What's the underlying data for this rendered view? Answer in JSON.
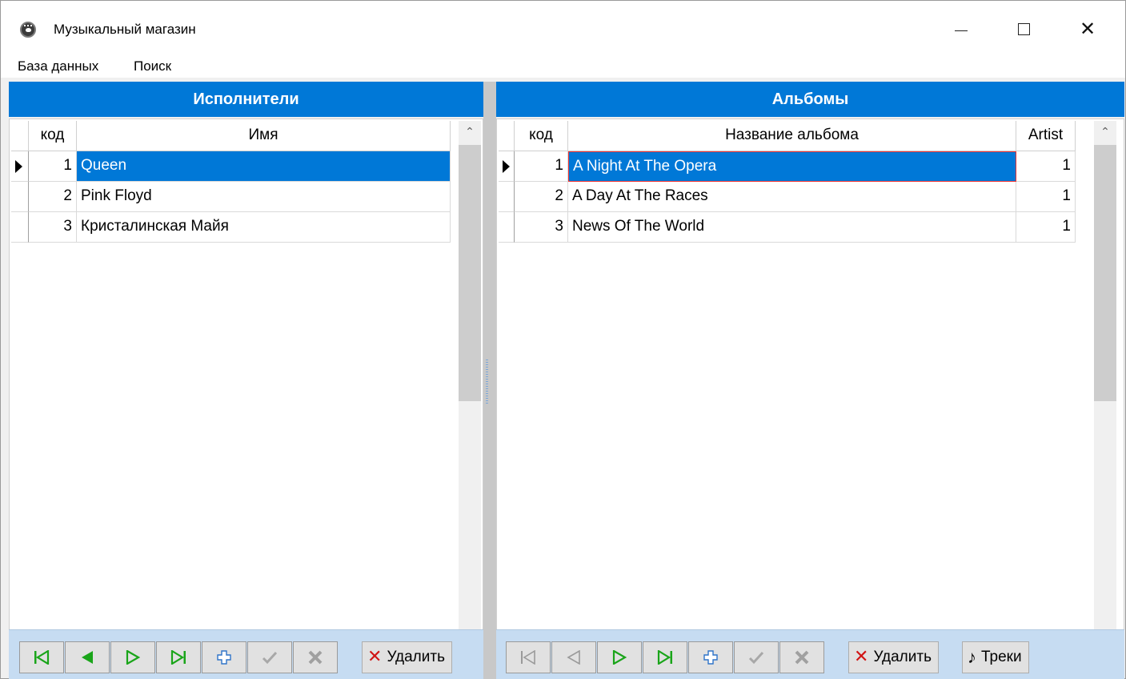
{
  "window": {
    "title": "Музыкальный магазин",
    "minimize": "",
    "maximize": "",
    "close": "✕"
  },
  "menu": {
    "database": "База данных",
    "search": "Поиск"
  },
  "colors": {
    "accent": "#0078d7",
    "toolbar_bg": "#c6dcf2",
    "nav_green": "#1aa51a",
    "delete_red": "#d11414"
  },
  "artists": {
    "header": "Исполнители",
    "columns": {
      "id": "код",
      "name": "Имя"
    },
    "rows": [
      {
        "id": "1",
        "name": "Queen"
      },
      {
        "id": "2",
        "name": "Pink Floyd"
      },
      {
        "id": "3",
        "name": "Кристалинская Майя"
      }
    ],
    "selected_row": 1,
    "toolbar": {
      "nav": [
        "first-icon",
        "prior-icon",
        "next-icon",
        "last-icon",
        "insert-icon",
        "post-icon",
        "cancel-icon"
      ],
      "delete_label": "Удалить"
    }
  },
  "albums": {
    "header": "Альбомы",
    "columns": {
      "id": "код",
      "title": "Название альбома",
      "artist": "Artist"
    },
    "rows": [
      {
        "id": "1",
        "title": "A Night At The Opera",
        "artist": "1"
      },
      {
        "id": "2",
        "title": "A Day At The Races",
        "artist": "1"
      },
      {
        "id": "3",
        "title": "News Of The World",
        "artist": "1"
      }
    ],
    "selected_row": 1,
    "toolbar": {
      "nav": [
        "first-icon",
        "prior-icon",
        "next-icon",
        "last-icon",
        "insert-icon",
        "post-icon",
        "cancel-icon"
      ],
      "delete_label": "Удалить",
      "tracks_label": "Треки"
    }
  }
}
